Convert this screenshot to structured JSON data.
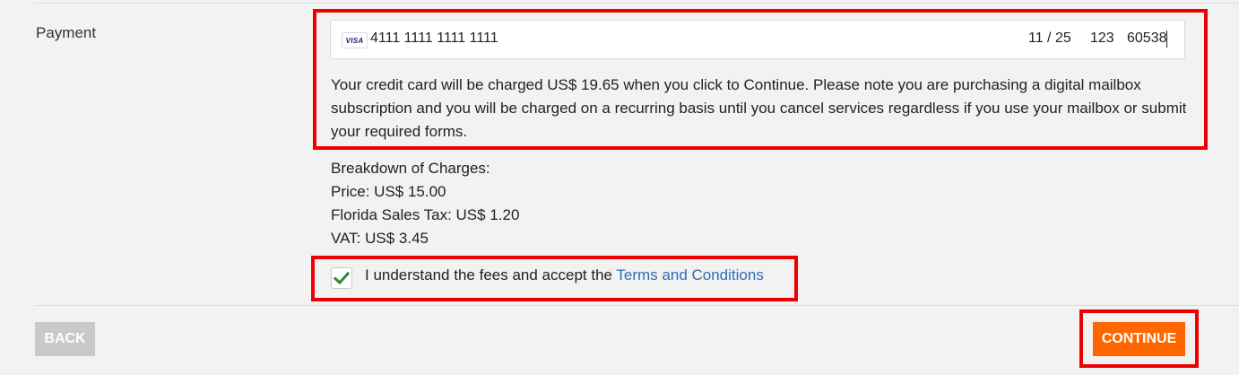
{
  "payment": {
    "label": "Payment",
    "card": {
      "brand_icon": "visa-icon",
      "brand_text": "VISA",
      "number": "4111 1111 1111 1111",
      "expiry": "11 / 25",
      "cvc": "123",
      "zip": "60538"
    },
    "charge_note": "Your credit card will be charged US$ 19.65 when you click to Continue. Please note you are purchasing a digital mailbox subscription and you will be charged on a recurring basis until you cancel services regardless if you use your mailbox or submit your required forms."
  },
  "breakdown": {
    "heading": "Breakdown of Charges:",
    "price": "Price: US$ 15.00",
    "tax": "Florida Sales Tax: US$ 1.20",
    "vat": "VAT: US$ 3.45"
  },
  "terms": {
    "checked": true,
    "text": "I understand the fees and accept the ",
    "link": "Terms and Conditions"
  },
  "actions": {
    "back": "BACK",
    "continue": "CONTINUE"
  },
  "colors": {
    "highlight_border": "#ee0000",
    "continue_bg": "#ff6600",
    "back_bg": "#c9c9c9",
    "link": "#2f6db3",
    "check": "#2e8b2e"
  }
}
